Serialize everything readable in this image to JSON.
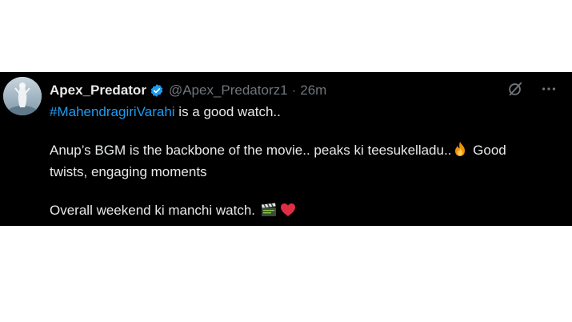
{
  "tweet": {
    "display_name": "Apex_Predator",
    "handle": "@Apex_Predatorz1",
    "separator": "·",
    "time": "26m",
    "hashtag": "#MahendragiriVarahi",
    "line1_rest": " is a good watch..",
    "line2_text": "Anup’s BGM is the backbone of the movie.. peaks ki teesukelladu..",
    "line2_after_emoji": " Good",
    "line3_text": "twists, engaging moments",
    "line4_text": "Overall weekend ki manchi watch. ",
    "emojis": [
      "fire-emoji",
      "clapper-board-emoji",
      "red-heart-emoji"
    ],
    "colors": {
      "background": "#000000",
      "text": "#e7e9ea",
      "muted": "#71767b",
      "link": "#1d9bf0",
      "verified": "#1d9bf0"
    }
  }
}
